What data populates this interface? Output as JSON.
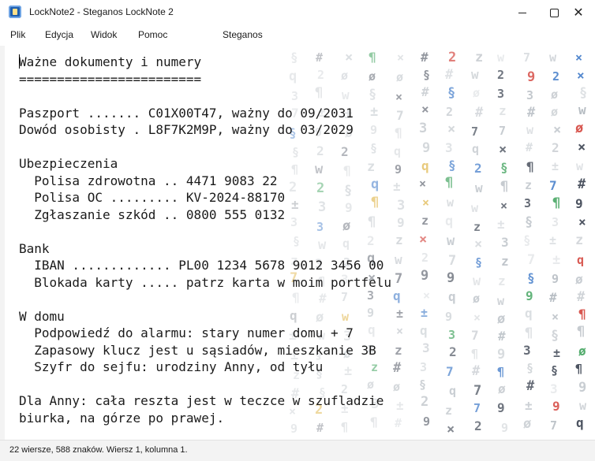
{
  "window": {
    "title": "LockNote2 - Steganos LockNote 2"
  },
  "menu": [
    "Plik",
    "Edycja",
    "Widok",
    "Pomoc",
    "Steganos"
  ],
  "document": {
    "lines": [
      "Ważne dokumenty i numery",
      "========================",
      "",
      "Paszport ....... C01X00T47, ważny do 09/2031",
      "Dowód osobisty . L8F7K2M9P, ważny do 03/2029",
      "",
      "Ubezpieczenia",
      "  Polisa zdrowotna .. 4471 9083 22",
      "  Polisa OC ......... KV-2024-88170",
      "  Zgłaszanie szkód .. 0800 555 0132",
      "",
      "Bank",
      "  IBAN ............. PL00 1234 5678 9012 3456 00",
      "  Blokada karty ..... patrz karta w moim portfelu",
      "",
      "W domu",
      "  Podpowiedź do alarmu: stary numer domu + 7",
      "  Zapasowy klucz jest u sąsiadów, mieszkanie 3B",
      "  Szyfr do sejfu: urodziny Anny, od tyłu",
      "",
      "Dla Anny: cała reszta jest w teczce w szufladzie",
      "biurka, na górze po prawej."
    ]
  },
  "background": {
    "glyphs": "9±#q¶§2ø3z×w7",
    "colors": {
      "grey": "#8c96a0",
      "dark": "#3a4250",
      "blue": "#2f6fc4",
      "red": "#d0342c",
      "green": "#2e9a4e",
      "gold": "#d9a520"
    }
  },
  "status": {
    "text": "22 wiersze, 588 znaków. Wiersz 1, kolumna 1."
  }
}
